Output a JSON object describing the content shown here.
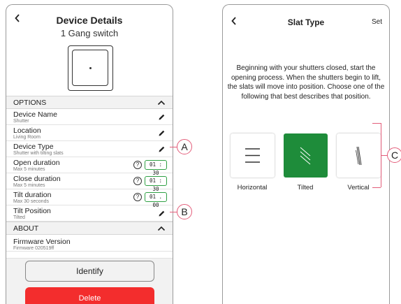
{
  "device_details": {
    "title": "Device Details",
    "subtitle": "1 Gang switch",
    "options_header": "OPTIONS",
    "rows": [
      {
        "label": "Device Name",
        "sub": "Shutter"
      },
      {
        "label": "Location",
        "sub": "Living Room"
      },
      {
        "label": "Device Type",
        "sub": "Shutter with tilting slats"
      },
      {
        "label": "Open duration",
        "sub": "Max 5 minutes",
        "value": "01 : 30"
      },
      {
        "label": "Close duration",
        "sub": "Max 5 minutes",
        "value": "01 : 30"
      },
      {
        "label": "Tilt duration",
        "sub": "Max 30 seconds",
        "value": "01 . 00"
      },
      {
        "label": "Tilt Position",
        "sub": "Tilted"
      }
    ],
    "about_header": "ABOUT",
    "firmware_label": "Firmware Version",
    "firmware_value": "Firmware 020519ff",
    "identify_label": "Identify",
    "delete_label": "Delete",
    "help_glyph": "?"
  },
  "slat_type": {
    "title": "Slat Type",
    "set_label": "Set",
    "description": "Beginning with your shutters closed, start the opening process. When the shutters begin to lift, the slats will move into position. Choose one of the following that best describes that position.",
    "options": [
      {
        "label": "Horizontal",
        "icon": "horizontal-slats-icon",
        "selected": false
      },
      {
        "label": "Tilted",
        "icon": "tilted-slats-icon",
        "selected": true
      },
      {
        "label": "Vertical",
        "icon": "vertical-slats-icon",
        "selected": false
      }
    ]
  },
  "callouts": {
    "a": "A",
    "b": "B",
    "c": "C"
  },
  "colors": {
    "accent_green": "#1e8c3a",
    "delete_red": "#f32d2d",
    "callout_pink": "#e35d7a"
  }
}
